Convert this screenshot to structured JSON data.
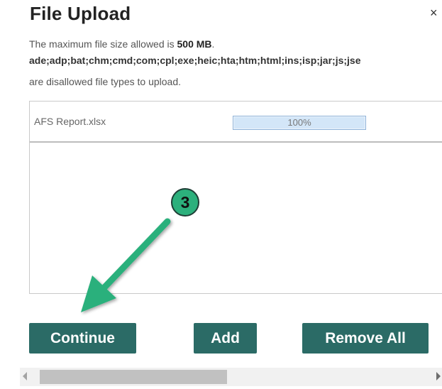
{
  "dialog": {
    "title": "File Upload",
    "close_glyph": "×",
    "info_prefix": "The maximum file size allowed is ",
    "max_size": "500 MB",
    "info_suffix": ".",
    "disallowed_types": "ade;adp;bat;chm;cmd;com;cpl;exe;heic;hta;htm;html;ins;isp;jar;js;jse",
    "disallowed_note": "are disallowed file types to upload."
  },
  "files": [
    {
      "name": "AFS Report.xlsx",
      "progress_label": "100%",
      "progress": 1.0
    }
  ],
  "buttons": {
    "continue": "Continue",
    "add": "Add",
    "remove_all": "Remove All"
  },
  "annotation": {
    "step_number": "3",
    "color": "#2cb07c"
  },
  "colors": {
    "button_bg": "#2b6b66",
    "progress_border": "#8fb3d9"
  }
}
